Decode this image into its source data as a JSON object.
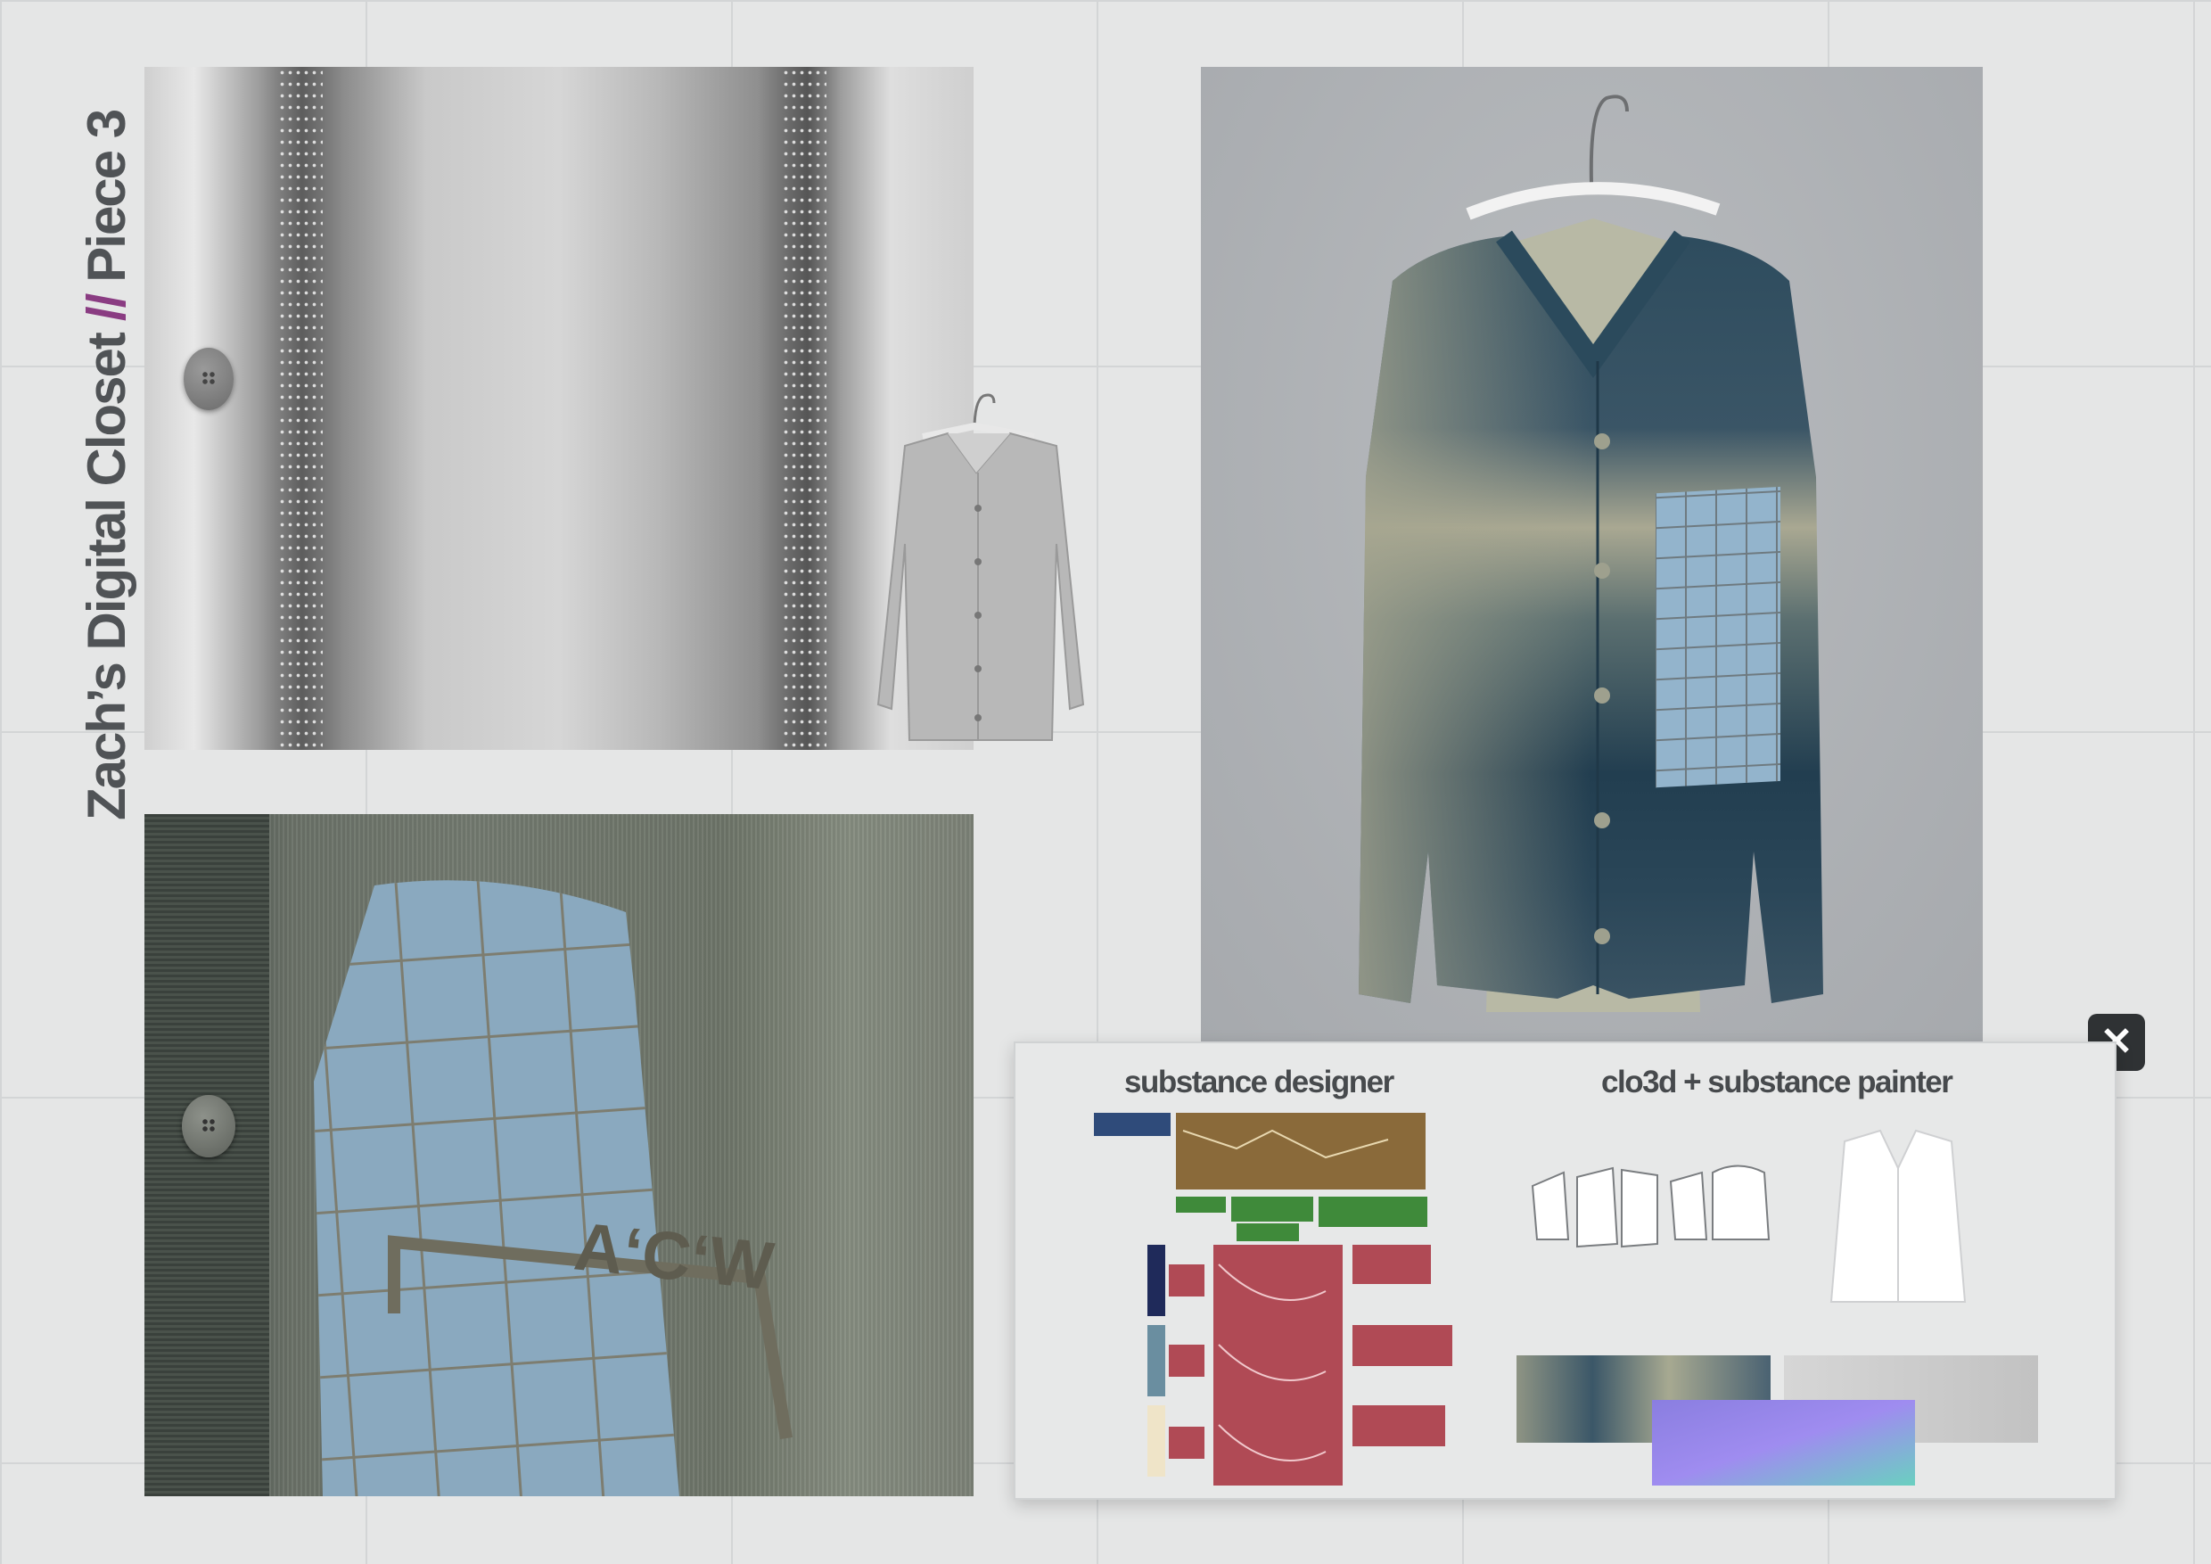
{
  "title": {
    "part1": "Zach’s Digital Closet",
    "separator": "//",
    "part2": "Piece 3"
  },
  "panels": {
    "top_left": "fabric-closeup-grey",
    "bottom_left": "fabric-closeup-print",
    "right": "cardigan-render"
  },
  "print": {
    "logo_text": "AʻCʻW"
  },
  "close_button": {
    "icon": "close-icon",
    "glyph": "✕"
  },
  "workflow": {
    "left_heading": "substance designer",
    "right_heading": "clo3d + substance painter"
  },
  "colors": {
    "title": "#505356",
    "accent": "#8a3c82",
    "cardigan_blue": "#2c4a5c",
    "cardigan_sand": "#a9a892",
    "print_blue": "#8fb0c8",
    "node_brown": "#8a6a3a",
    "node_green": "#3f8a3a",
    "node_red": "#b04a55"
  }
}
